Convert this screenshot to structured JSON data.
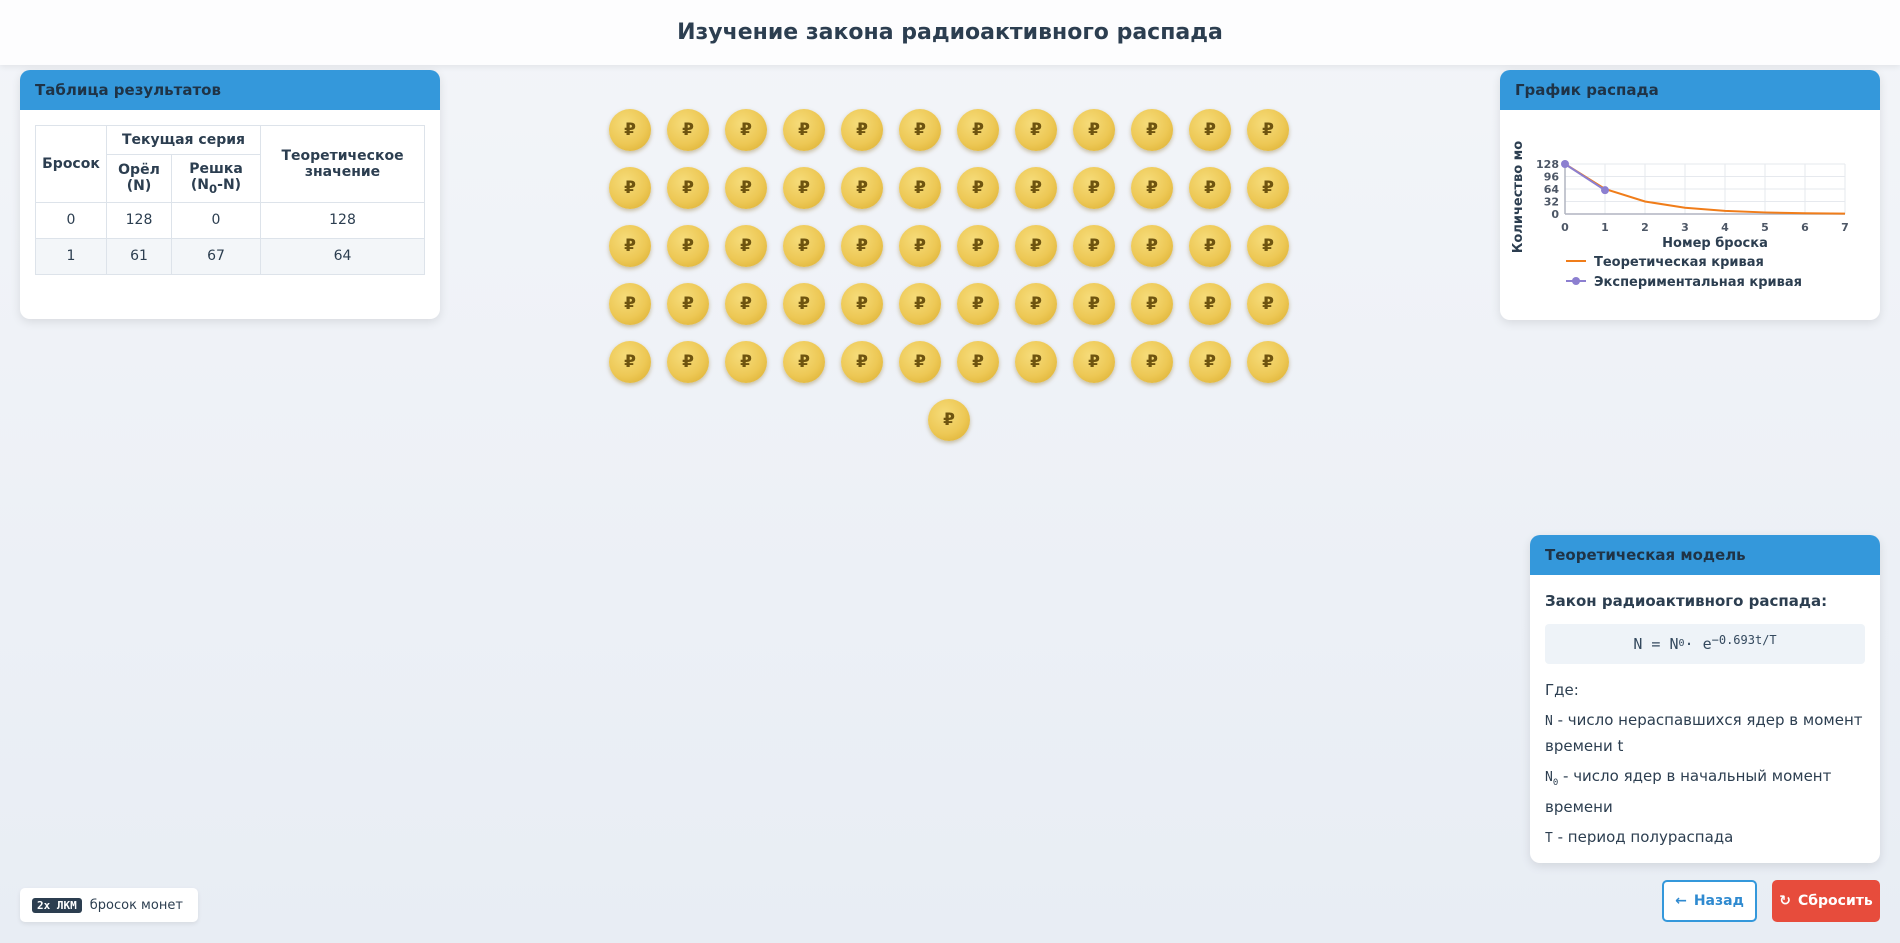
{
  "title": "Изучение закона радиоактивного распада",
  "results": {
    "header": "Таблица результатов",
    "col_throw": "Бросок",
    "col_series": "Текущая серия",
    "col_heads": "Орёл (N)",
    "col_tails_main": "Решка",
    "col_tails_paren": "(N",
    "col_tails_sub": "0",
    "col_tails_end": "-N)",
    "col_theory": "Теоретическое значение",
    "rows": [
      {
        "throw": "0",
        "heads": "128",
        "tails": "0",
        "theory": "128"
      },
      {
        "throw": "1",
        "heads": "61",
        "tails": "67",
        "theory": "64"
      }
    ]
  },
  "chart_panel": {
    "header": "График распада"
  },
  "chart_data": {
    "type": "line",
    "xlabel": "Номер броска",
    "ylabel": "Количество мо",
    "x_ticks": [
      "0",
      "1",
      "2",
      "3",
      "4",
      "5",
      "6",
      "7"
    ],
    "y_ticks": [
      "128",
      "96",
      "64",
      "32",
      "0"
    ],
    "xlim": [
      0,
      7
    ],
    "ylim": [
      0,
      128
    ],
    "grid": true,
    "legend_position": "bottom",
    "series": [
      {
        "name": "Теоретическая кривая",
        "color": "#f07d1a",
        "x": [
          0,
          1,
          2,
          3,
          4,
          5,
          6,
          7
        ],
        "y": [
          128,
          64,
          32,
          16,
          8,
          4,
          2,
          1
        ]
      },
      {
        "name": "Экспериментальная кривая",
        "color": "#8c7fd0",
        "x": [
          0,
          1
        ],
        "y": [
          128,
          61
        ]
      }
    ]
  },
  "coins": {
    "symbol": "₽",
    "count": 61,
    "color": "#edc855"
  },
  "theory": {
    "header": "Теоретическая модель",
    "law": "Закон радиоактивного распада:",
    "formula_main": "N = N",
    "formula_sub": "0",
    "formula_mid": " · e",
    "formula_exp": "−0.693t/T",
    "where": "Где:",
    "n_symbol": "N",
    "n_desc": " - число нераспавшихся ядер в момент времени t",
    "n0_symbol": "N",
    "n0_sub": "0",
    "n0_desc": " - число ядер в начальный момент времени",
    "t_symbol": "T",
    "t_desc": " - период полураспада"
  },
  "hint": {
    "key": "2x ЛКМ",
    "text": "бросок монет"
  },
  "buttons": {
    "back_icon": "←",
    "back": "Назад",
    "reset_icon": "↻",
    "reset": "Сбросить"
  },
  "colors": {
    "accent": "#3498db",
    "danger": "#e74c3c"
  }
}
